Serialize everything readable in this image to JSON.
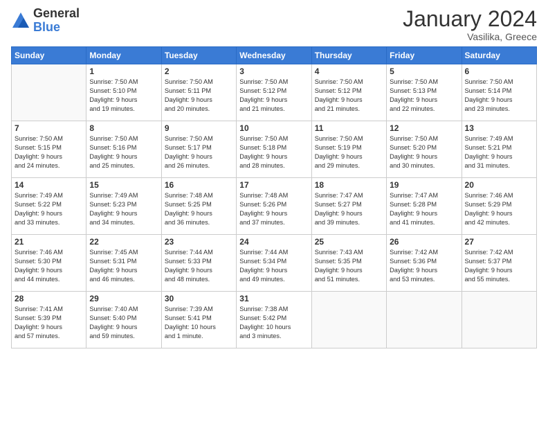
{
  "logo": {
    "general": "General",
    "blue": "Blue"
  },
  "title": "January 2024",
  "location": "Vasilika, Greece",
  "days_of_week": [
    "Sunday",
    "Monday",
    "Tuesday",
    "Wednesday",
    "Thursday",
    "Friday",
    "Saturday"
  ],
  "weeks": [
    [
      {
        "day": "",
        "info": ""
      },
      {
        "day": "1",
        "info": "Sunrise: 7:50 AM\nSunset: 5:10 PM\nDaylight: 9 hours\nand 19 minutes."
      },
      {
        "day": "2",
        "info": "Sunrise: 7:50 AM\nSunset: 5:11 PM\nDaylight: 9 hours\nand 20 minutes."
      },
      {
        "day": "3",
        "info": "Sunrise: 7:50 AM\nSunset: 5:12 PM\nDaylight: 9 hours\nand 21 minutes."
      },
      {
        "day": "4",
        "info": "Sunrise: 7:50 AM\nSunset: 5:12 PM\nDaylight: 9 hours\nand 21 minutes."
      },
      {
        "day": "5",
        "info": "Sunrise: 7:50 AM\nSunset: 5:13 PM\nDaylight: 9 hours\nand 22 minutes."
      },
      {
        "day": "6",
        "info": "Sunrise: 7:50 AM\nSunset: 5:14 PM\nDaylight: 9 hours\nand 23 minutes."
      }
    ],
    [
      {
        "day": "7",
        "info": "Sunrise: 7:50 AM\nSunset: 5:15 PM\nDaylight: 9 hours\nand 24 minutes."
      },
      {
        "day": "8",
        "info": "Sunrise: 7:50 AM\nSunset: 5:16 PM\nDaylight: 9 hours\nand 25 minutes."
      },
      {
        "day": "9",
        "info": "Sunrise: 7:50 AM\nSunset: 5:17 PM\nDaylight: 9 hours\nand 26 minutes."
      },
      {
        "day": "10",
        "info": "Sunrise: 7:50 AM\nSunset: 5:18 PM\nDaylight: 9 hours\nand 28 minutes."
      },
      {
        "day": "11",
        "info": "Sunrise: 7:50 AM\nSunset: 5:19 PM\nDaylight: 9 hours\nand 29 minutes."
      },
      {
        "day": "12",
        "info": "Sunrise: 7:50 AM\nSunset: 5:20 PM\nDaylight: 9 hours\nand 30 minutes."
      },
      {
        "day": "13",
        "info": "Sunrise: 7:49 AM\nSunset: 5:21 PM\nDaylight: 9 hours\nand 31 minutes."
      }
    ],
    [
      {
        "day": "14",
        "info": "Sunrise: 7:49 AM\nSunset: 5:22 PM\nDaylight: 9 hours\nand 33 minutes."
      },
      {
        "day": "15",
        "info": "Sunrise: 7:49 AM\nSunset: 5:23 PM\nDaylight: 9 hours\nand 34 minutes."
      },
      {
        "day": "16",
        "info": "Sunrise: 7:48 AM\nSunset: 5:25 PM\nDaylight: 9 hours\nand 36 minutes."
      },
      {
        "day": "17",
        "info": "Sunrise: 7:48 AM\nSunset: 5:26 PM\nDaylight: 9 hours\nand 37 minutes."
      },
      {
        "day": "18",
        "info": "Sunrise: 7:47 AM\nSunset: 5:27 PM\nDaylight: 9 hours\nand 39 minutes."
      },
      {
        "day": "19",
        "info": "Sunrise: 7:47 AM\nSunset: 5:28 PM\nDaylight: 9 hours\nand 41 minutes."
      },
      {
        "day": "20",
        "info": "Sunrise: 7:46 AM\nSunset: 5:29 PM\nDaylight: 9 hours\nand 42 minutes."
      }
    ],
    [
      {
        "day": "21",
        "info": "Sunrise: 7:46 AM\nSunset: 5:30 PM\nDaylight: 9 hours\nand 44 minutes."
      },
      {
        "day": "22",
        "info": "Sunrise: 7:45 AM\nSunset: 5:31 PM\nDaylight: 9 hours\nand 46 minutes."
      },
      {
        "day": "23",
        "info": "Sunrise: 7:44 AM\nSunset: 5:33 PM\nDaylight: 9 hours\nand 48 minutes."
      },
      {
        "day": "24",
        "info": "Sunrise: 7:44 AM\nSunset: 5:34 PM\nDaylight: 9 hours\nand 49 minutes."
      },
      {
        "day": "25",
        "info": "Sunrise: 7:43 AM\nSunset: 5:35 PM\nDaylight: 9 hours\nand 51 minutes."
      },
      {
        "day": "26",
        "info": "Sunrise: 7:42 AM\nSunset: 5:36 PM\nDaylight: 9 hours\nand 53 minutes."
      },
      {
        "day": "27",
        "info": "Sunrise: 7:42 AM\nSunset: 5:37 PM\nDaylight: 9 hours\nand 55 minutes."
      }
    ],
    [
      {
        "day": "28",
        "info": "Sunrise: 7:41 AM\nSunset: 5:39 PM\nDaylight: 9 hours\nand 57 minutes."
      },
      {
        "day": "29",
        "info": "Sunrise: 7:40 AM\nSunset: 5:40 PM\nDaylight: 9 hours\nand 59 minutes."
      },
      {
        "day": "30",
        "info": "Sunrise: 7:39 AM\nSunset: 5:41 PM\nDaylight: 10 hours\nand 1 minute."
      },
      {
        "day": "31",
        "info": "Sunrise: 7:38 AM\nSunset: 5:42 PM\nDaylight: 10 hours\nand 3 minutes."
      },
      {
        "day": "",
        "info": ""
      },
      {
        "day": "",
        "info": ""
      },
      {
        "day": "",
        "info": ""
      }
    ]
  ]
}
